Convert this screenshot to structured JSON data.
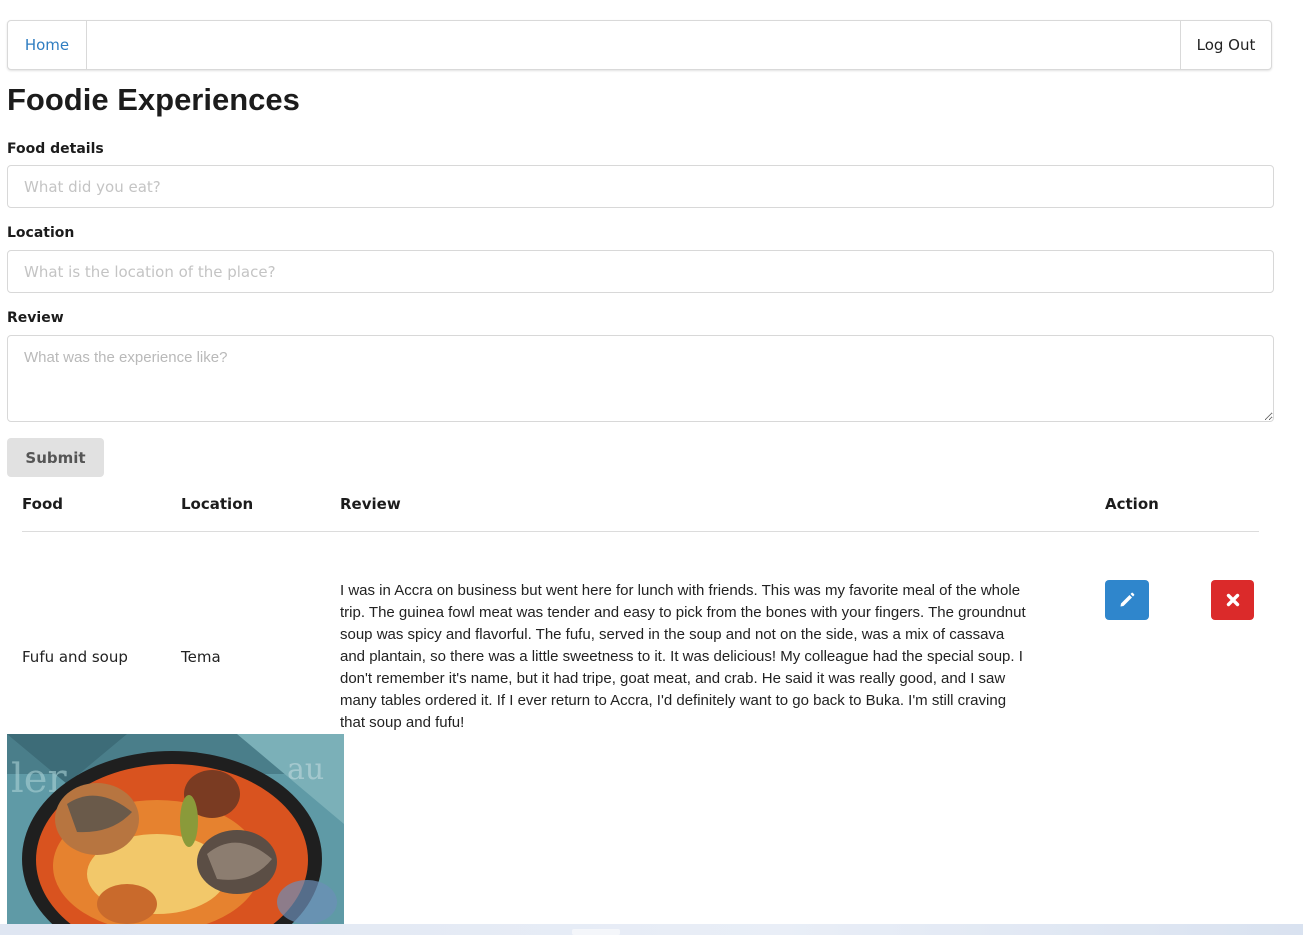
{
  "nav": {
    "home_label": "Home",
    "logout_label": "Log Out"
  },
  "page": {
    "title": "Foodie Experiences"
  },
  "form": {
    "food_label": "Food details",
    "food_placeholder": "What did you eat?",
    "location_label": "Location",
    "location_placeholder": "What is the location of the place?",
    "review_label": "Review",
    "review_placeholder": "What was the experience like?",
    "submit_label": "Submit"
  },
  "table": {
    "headers": {
      "food": "Food",
      "location": "Location",
      "review": "Review",
      "action": "Action"
    },
    "rows": [
      {
        "food": "Fufu and soup",
        "location": "Tema",
        "review": "I was in Accra on business but went here for lunch with friends. This was my favorite meal of the whole trip. The guinea fowl meat was tender and easy to pick from the bones with your fingers. The groundnut soup was spicy and flavorful. The fufu, served in the soup and not on the side, was a mix of cassava and plantain, so there was a little sweetness to it. It was delicious! My colleague had the special soup. I don't remember it's name, but it had tripe, goat meat, and crab. He said it was really good, and I saw many tables ordered it. If I ever return to Accra, I'd definitely want to go back to Buka. I'm still craving that soup and fufu!"
      }
    ]
  },
  "icons": {
    "edit": "pencil-icon",
    "delete": "close-icon"
  },
  "colors": {
    "link": "#2f7dc1",
    "edit_button": "#2f86cc",
    "delete_button": "#db2a2a",
    "submit_button": "#e1e1e1"
  }
}
